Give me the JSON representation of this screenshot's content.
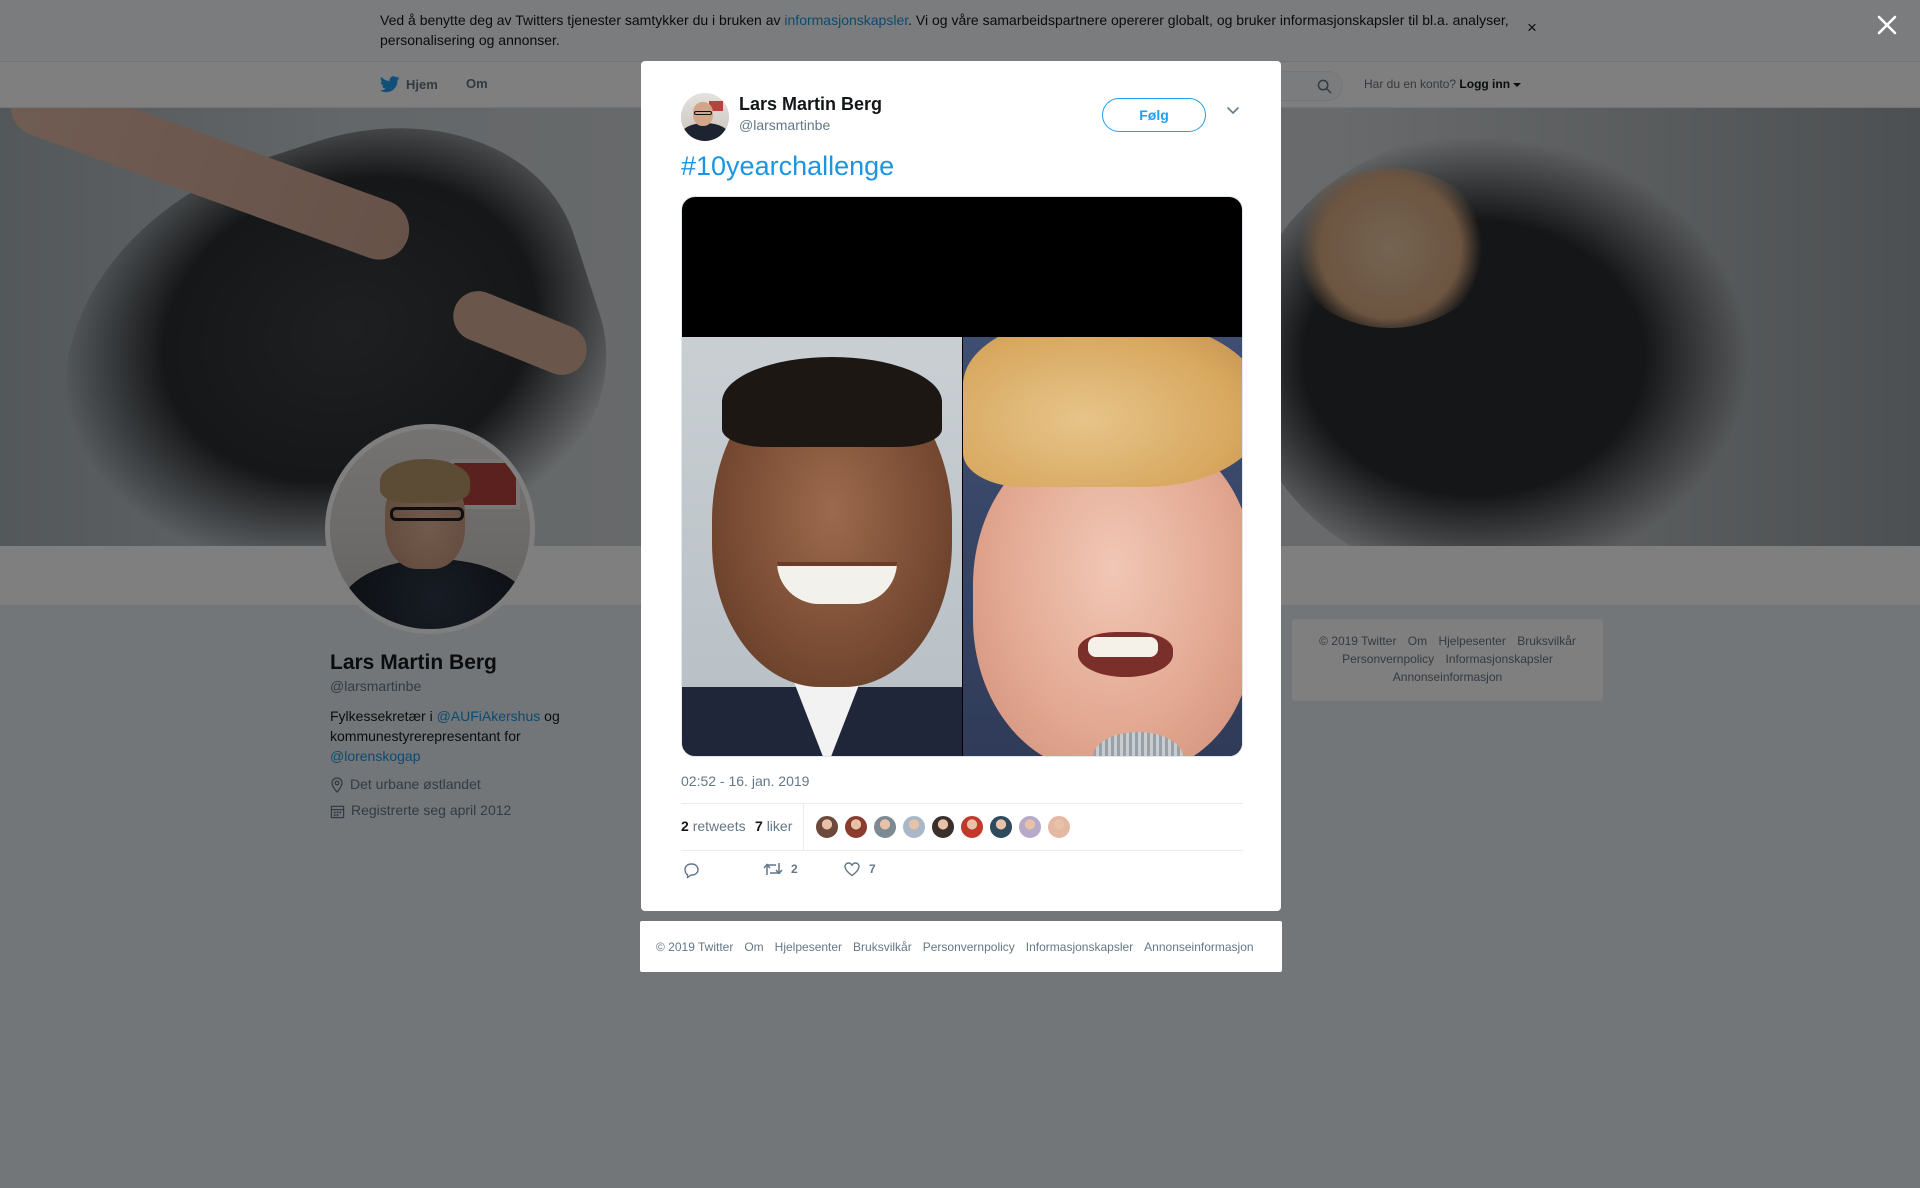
{
  "cookie_bar": {
    "text_before": "Ved å benytte deg av Twitters tjenester samtykker du i bruken av ",
    "link": "informasjonskapsler",
    "text_after": ". Vi og våre samarbeidspartnere opererer globalt, og bruker informasjonskapsler til bl.a. analyser, personalisering og annonser.",
    "close": "×"
  },
  "nav": {
    "home": "Hjem",
    "about": "Om",
    "account_prompt": "Har du en konto?",
    "login": "Logg inn"
  },
  "profile": {
    "name": "Lars Martin Berg",
    "handle": "@larsmartinbe",
    "bio_prefix": "Fylkessekretær i ",
    "bio_link1": "@AUFiAkershus",
    "bio_middle": " og kommunestyrerepresentant for ",
    "bio_link2": "@lorenskogap",
    "location": "Det urbane østlandet",
    "joined": "Registrerte seg april 2012"
  },
  "side_footer": [
    "© 2019 Twitter",
    "Om",
    "Hjelpesenter",
    "Bruksvilkår",
    "Personvernpolicy",
    "Informasjonskapsler",
    "Annonseinformasjon"
  ],
  "tweet": {
    "author_name": "Lars Martin Berg",
    "author_handle": "@larsmartinbe",
    "follow_label": "Følg",
    "hashtag": "#10yearchallenge",
    "timestamp": "02:52 - 16. jan. 2019",
    "retweets_count": "2",
    "retweets_label": "retweets",
    "likes_count": "7",
    "likes_label": "liker",
    "action_retweet_count": "2",
    "action_like_count": "7",
    "liker_colors": [
      "#6b4a3c",
      "#8c3b2f",
      "#7d8a94",
      "#a9b8c6",
      "#3a2f2a",
      "#c0392b",
      "#2d4a5e",
      "#b7a9c9",
      "#e3b9a3"
    ]
  },
  "modal_footer": [
    "© 2019 Twitter",
    "Om",
    "Hjelpesenter",
    "Bruksvilkår",
    "Personvernpolicy",
    "Informasjonskapsler",
    "Annonseinformasjon"
  ],
  "colors": {
    "accent": "#1da1f2",
    "link": "#1b95e0",
    "overlay": "rgba(0,0,0,0.5)"
  }
}
